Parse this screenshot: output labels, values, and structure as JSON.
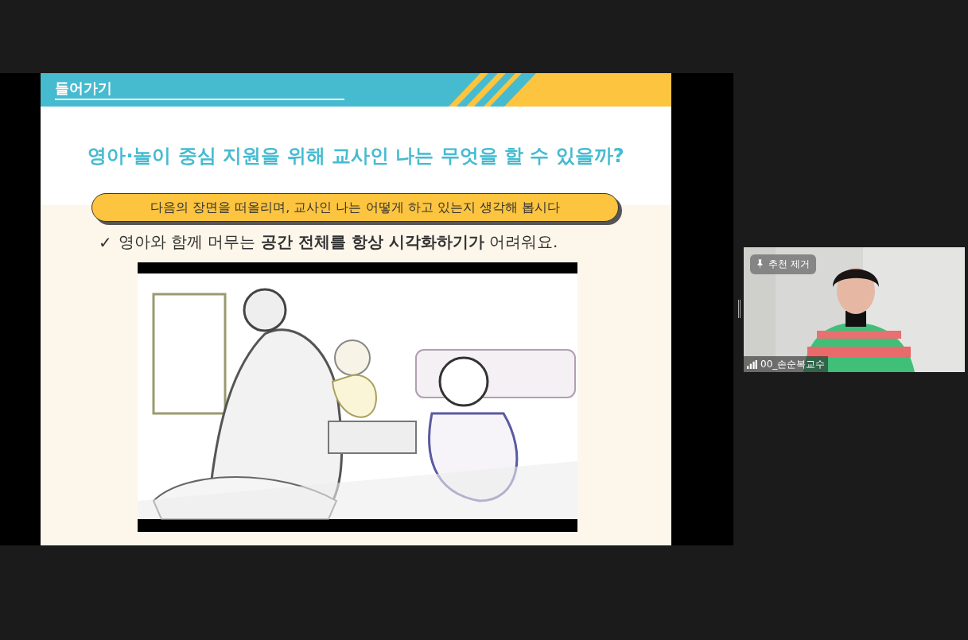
{
  "slide": {
    "section_title": "들어가기",
    "heading": "영아·놀이 중심 지원을 위해 교사인 나는 무엇을 할 수 있을까?",
    "prompt": "다음의 장면을 떠올리며, 교사인 나는 어떻게 하고 있는지 생각해 봅시다",
    "bullet": {
      "mark": "✓",
      "text": "영아와 함께 머무는 **공간 전체를 항상 시각화하기가** 어려워요."
    }
  },
  "participant": {
    "pin_label": "추천 제거",
    "name": "00_손순복교수"
  }
}
